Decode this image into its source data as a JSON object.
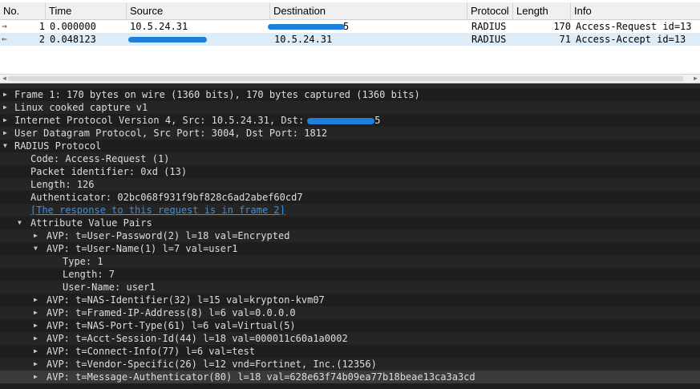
{
  "packet_list": {
    "columns": {
      "no": "No.",
      "time": "Time",
      "source": "Source",
      "destination": "Destination",
      "protocol": "Protocol",
      "length": "Length",
      "info": "Info"
    },
    "rows": [
      {
        "no": "1",
        "time": "0.000000",
        "source": "10.5.24.31",
        "destination_suffix": "5",
        "protocol": "RADIUS",
        "length": "170",
        "info": "Access-Request id=13"
      },
      {
        "no": "2",
        "time": "0.048123",
        "destination": "10.5.24.31",
        "protocol": "RADIUS",
        "length": "71",
        "info": "Access-Accept id=13"
      }
    ]
  },
  "details": {
    "frame": "Frame 1: 170 bytes on wire (1360 bits), 170 bytes captured (1360 bits)",
    "sll": "Linux cooked capture v1",
    "ip_prefix": "Internet Protocol Version 4, Src: 10.5.24.31, Dst:",
    "ip_suffix": "5",
    "udp": "User Datagram Protocol, Src Port: 3004, Dst Port: 1812",
    "radius": "RADIUS Protocol",
    "code": "Code: Access-Request (1)",
    "packet_identifier": "Packet identifier: 0xd (13)",
    "length": "Length: 126",
    "authenticator": "Authenticator: 02bc068f931f9bf828c6ad2abef60cd7",
    "response_link": "[The response to this request is in frame 2]",
    "avp_header": "Attribute Value Pairs",
    "avp_user_password": "AVP: t=User-Password(2) l=18 val=Encrypted",
    "avp_user_name": "AVP: t=User-Name(1) l=7 val=user1",
    "un_type": "Type: 1",
    "un_length": "Length: 7",
    "un_user_name": "User-Name: user1",
    "avp_nas_identifier": "AVP: t=NAS-Identifier(32) l=15 val=krypton-kvm07",
    "avp_framed_ip": "AVP: t=Framed-IP-Address(8) l=6 val=0.0.0.0",
    "avp_nas_port_type": "AVP: t=NAS-Port-Type(61) l=6 val=Virtual(5)",
    "avp_acct_session": "AVP: t=Acct-Session-Id(44) l=18 val=000011c60a1a0002",
    "avp_connect_info": "AVP: t=Connect-Info(77) l=6 val=test",
    "avp_vendor_specific": "AVP: t=Vendor-Specific(26) l=12 vnd=Fortinet, Inc.(12356)",
    "avp_message_auth": "AVP: t=Message-Authenticator(80) l=18 val=628e63f74b09ea77b18beae13ca3a3cd"
  },
  "icons": {
    "collapsed": "chevron-right-icon",
    "expanded": "chevron-down-icon",
    "request_arrow": "request-arrow-icon",
    "response_arrow": "response-arrow-icon"
  },
  "colors": {
    "selected_row": "#dcecf9",
    "link": "#3d8fe0",
    "redaction": "#1e7fdc",
    "tree_bg": "#1e1e1e"
  }
}
